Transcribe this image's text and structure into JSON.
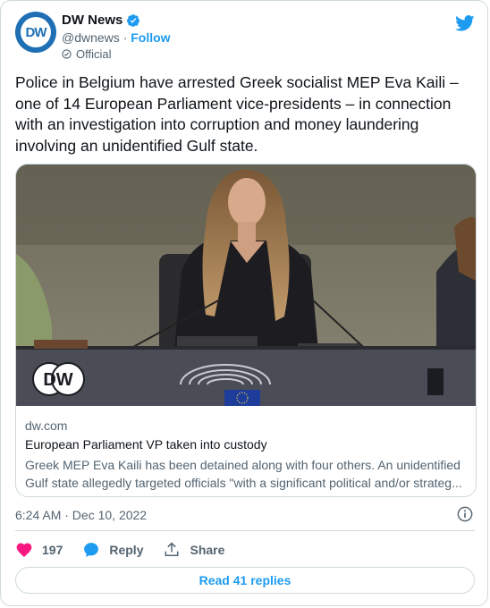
{
  "account": {
    "display_name": "DW News",
    "handle": "@dwnews",
    "separator": "·",
    "follow_label": "Follow",
    "badge_label": "Official",
    "avatar_logo": "DW"
  },
  "tweet": {
    "text": "Police in Belgium have arrested Greek socialist MEP Eva Kaili – one of 14 European Parliament vice-presidents – in connection with an investigation into corruption and money laundering involving an unidentified Gulf state.",
    "timestamp": "6:24 AM · Dec 10, 2022"
  },
  "link_card": {
    "image_logo": "DW",
    "domain": "dw.com",
    "title": "European Parliament VP taken into custody",
    "description_line1": "Greek MEP Eva Kaili has been detained along with four others. An unidentified",
    "description_line2": "Gulf state allegedly targeted officials \"with a significant political and/or strateg..."
  },
  "actions": {
    "like_count": "197",
    "reply_label": "Reply",
    "share_label": "Share",
    "read_replies_label": "Read 41 replies"
  },
  "colors": {
    "accent": "#1d9bf0",
    "like": "#f91880",
    "dw_blue": "#1f6fb5",
    "text_secondary": "#536471",
    "border": "#cfd9de"
  },
  "icons": [
    "verified-badge-icon",
    "twitter-bird-icon",
    "official-badge-icon",
    "info-icon",
    "heart-icon",
    "reply-bubble-icon",
    "share-icon"
  ]
}
